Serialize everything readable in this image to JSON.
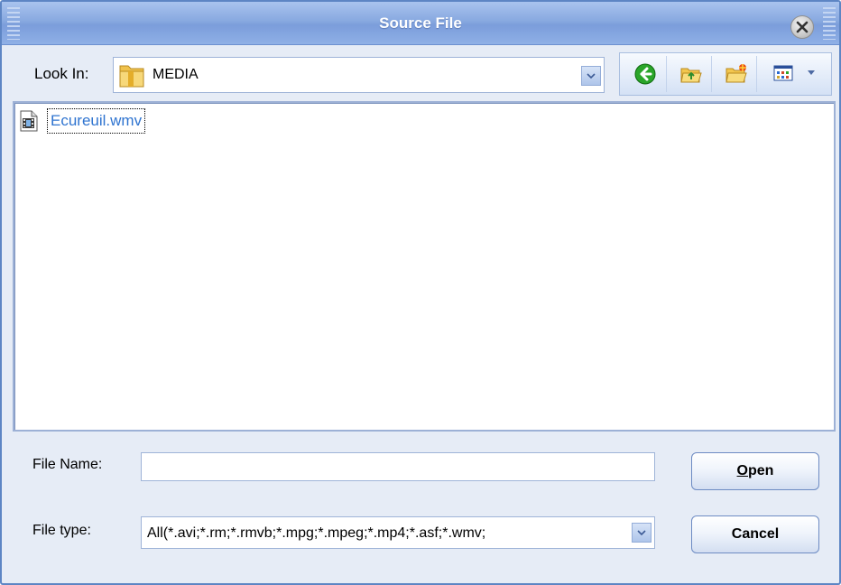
{
  "window": {
    "title": "Source File"
  },
  "look_in": {
    "label": "Look In:",
    "value": "MEDIA"
  },
  "toolbar": {
    "icons": [
      "back-icon",
      "up-folder-icon",
      "new-folder-icon",
      "view-menu-icon"
    ]
  },
  "file_list": {
    "items": [
      {
        "name": "Ecureuil.wmv",
        "icon": "video-file-icon"
      }
    ]
  },
  "form": {
    "file_name_label": "File Name:",
    "file_name_value": "",
    "file_type_label": "File type:",
    "file_type_value": "All(*.avi;*.rm;*.rmvb;*.mpg;*.mpeg;*.mp4;*.asf;*.wmv;"
  },
  "buttons": {
    "open_mnemonic": "O",
    "open_rest": "pen",
    "cancel_label": "Cancel"
  },
  "colors": {
    "title_bar": "#88a9e0",
    "file_link": "#2f74d0",
    "border": "#5d85c4"
  }
}
